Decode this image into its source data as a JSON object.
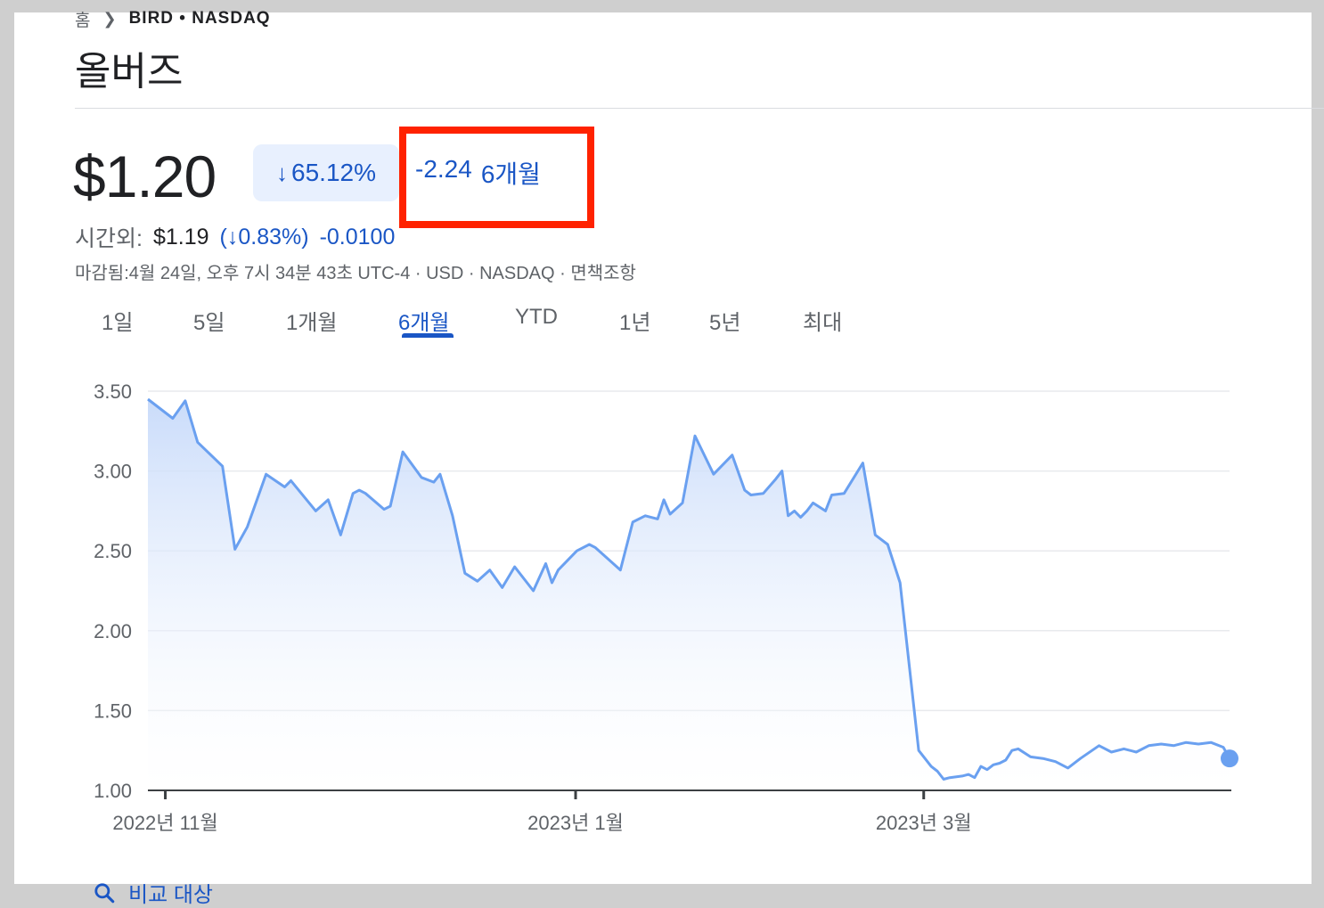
{
  "breadcrumb": {
    "home": "홈",
    "symbol": "BIRD • NASDAQ"
  },
  "stock": {
    "name": "올버즈",
    "price": "$1.20",
    "change_percent": "65.12%",
    "change_abs": "-2.24",
    "change_period": "6개월",
    "after_hours": {
      "label": "시간외:",
      "price": "$1.19",
      "percent": "(↓0.83%)",
      "change": "-0.0100"
    },
    "meta": "마감됨:4월 24일, 오후 7시 34분 43초 UTC-4 · USD · NASDAQ · 면책조항"
  },
  "tabs": [
    {
      "label": "1일"
    },
    {
      "label": "5일"
    },
    {
      "label": "1개월"
    },
    {
      "label": "6개월",
      "active": true
    },
    {
      "label": "YTD"
    },
    {
      "label": "1년"
    },
    {
      "label": "5년"
    },
    {
      "label": "최대"
    }
  ],
  "compare": {
    "label": "비교 대상"
  },
  "colors": {
    "accent": "#1a56c5",
    "line": "#6aa0f0",
    "highlight": "#ff2200"
  },
  "chart_data": {
    "type": "area",
    "ylim": [
      1.0,
      3.5
    ],
    "yticks": [
      "3.50",
      "3.00",
      "2.50",
      "2.00",
      "1.50",
      "1.00"
    ],
    "xticks": [
      {
        "label": "2022년 11월",
        "x": 2.8
      },
      {
        "label": "2023년 1월",
        "x": 68.8
      },
      {
        "label": "2023년 3월",
        "x": 124.8
      }
    ],
    "x": [
      0,
      4,
      6,
      8,
      12,
      14,
      16,
      19,
      22,
      23,
      27,
      29,
      31,
      33,
      34,
      35,
      38,
      39,
      41,
      44,
      46,
      47,
      49,
      51,
      53,
      55,
      57,
      59,
      62,
      64,
      65,
      66,
      69,
      71,
      72,
      76,
      78,
      80,
      82,
      83,
      84,
      86,
      88,
      91,
      94,
      96,
      97,
      99,
      101,
      102,
      103,
      104,
      105,
      106,
      107,
      109,
      110,
      112,
      115,
      117,
      119,
      121,
      124,
      126,
      127,
      128,
      129,
      131,
      132,
      133,
      134,
      135,
      136,
      137,
      138,
      139,
      140,
      142,
      144,
      146,
      148,
      150,
      153,
      155,
      157,
      159,
      161,
      163,
      165,
      167,
      169,
      171,
      173,
      174
    ],
    "values": [
      3.45,
      3.33,
      3.44,
      3.18,
      3.03,
      2.51,
      2.65,
      2.98,
      2.9,
      2.94,
      2.75,
      2.82,
      2.6,
      2.86,
      2.88,
      2.86,
      2.76,
      2.78,
      3.12,
      2.96,
      2.93,
      2.98,
      2.72,
      2.36,
      2.31,
      2.38,
      2.27,
      2.4,
      2.25,
      2.42,
      2.3,
      2.38,
      2.5,
      2.54,
      2.52,
      2.38,
      2.68,
      2.72,
      2.7,
      2.82,
      2.73,
      2.8,
      3.22,
      2.98,
      3.1,
      2.88,
      2.85,
      2.86,
      2.95,
      3.0,
      2.72,
      2.75,
      2.71,
      2.75,
      2.8,
      2.75,
      2.85,
      2.86,
      3.05,
      2.6,
      2.54,
      2.3,
      1.25,
      1.15,
      1.12,
      1.07,
      1.08,
      1.09,
      1.1,
      1.08,
      1.15,
      1.13,
      1.16,
      1.17,
      1.19,
      1.25,
      1.26,
      1.21,
      1.2,
      1.18,
      1.14,
      1.2,
      1.28,
      1.24,
      1.26,
      1.24,
      1.28,
      1.29,
      1.28,
      1.3,
      1.29,
      1.3,
      1.27,
      1.2
    ]
  }
}
